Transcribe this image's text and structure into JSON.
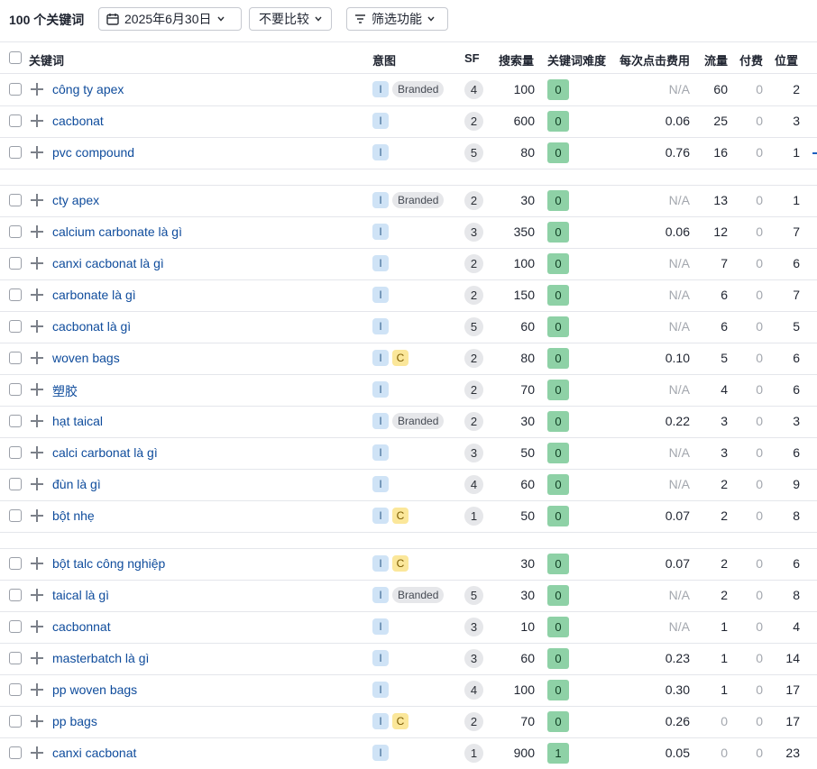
{
  "toolbar": {
    "title": "100 个关键词",
    "date_label": "2025年6月30日",
    "compare_label": "不要比较",
    "filter_label": "筛选功能"
  },
  "columns": {
    "keyword": "关键词",
    "intent": "意图",
    "sf": "SF",
    "volume": "搜索量",
    "kd": "关键词难度",
    "cpc": "每次点击费用",
    "traffic": "流量",
    "paid": "付费",
    "position": "位置"
  },
  "rows": [
    {
      "keyword": "công ty apex",
      "intent": [
        "I",
        "Branded"
      ],
      "sf": "4",
      "volume": "100",
      "kd": "0",
      "cpc": "N/A",
      "traffic": "60",
      "paid": "0",
      "position": "2"
    },
    {
      "keyword": "cacbonat",
      "intent": [
        "I"
      ],
      "sf": "2",
      "volume": "600",
      "kd": "0",
      "cpc": "0.06",
      "traffic": "25",
      "paid": "0",
      "position": "3"
    },
    {
      "keyword": "pvc compound",
      "intent": [
        "I"
      ],
      "sf": "5",
      "volume": "80",
      "kd": "0",
      "cpc": "0.76",
      "traffic": "16",
      "paid": "0",
      "position": "1"
    },
    {
      "keyword": "cty apex",
      "intent": [
        "I",
        "Branded"
      ],
      "sf": "2",
      "volume": "30",
      "kd": "0",
      "cpc": "N/A",
      "traffic": "13",
      "paid": "0",
      "position": "1"
    },
    {
      "keyword": "calcium carbonate là gì",
      "intent": [
        "I"
      ],
      "sf": "3",
      "volume": "350",
      "kd": "0",
      "cpc": "0.06",
      "traffic": "12",
      "paid": "0",
      "position": "7"
    },
    {
      "keyword": "canxi cacbonat là gì",
      "intent": [
        "I"
      ],
      "sf": "2",
      "volume": "100",
      "kd": "0",
      "cpc": "N/A",
      "traffic": "7",
      "paid": "0",
      "position": "6"
    },
    {
      "keyword": "carbonate là gì",
      "intent": [
        "I"
      ],
      "sf": "2",
      "volume": "150",
      "kd": "0",
      "cpc": "N/A",
      "traffic": "6",
      "paid": "0",
      "position": "7"
    },
    {
      "keyword": "cacbonat là gì",
      "intent": [
        "I"
      ],
      "sf": "5",
      "volume": "60",
      "kd": "0",
      "cpc": "N/A",
      "traffic": "6",
      "paid": "0",
      "position": "5"
    },
    {
      "keyword": "woven bags",
      "intent": [
        "I",
        "C"
      ],
      "sf": "2",
      "volume": "80",
      "kd": "0",
      "cpc": "0.10",
      "traffic": "5",
      "paid": "0",
      "position": "6"
    },
    {
      "keyword": "塑胶",
      "intent": [
        "I"
      ],
      "sf": "2",
      "volume": "70",
      "kd": "0",
      "cpc": "N/A",
      "traffic": "4",
      "paid": "0",
      "position": "6"
    },
    {
      "keyword": "hạt taical",
      "intent": [
        "I",
        "Branded"
      ],
      "sf": "2",
      "volume": "30",
      "kd": "0",
      "cpc": "0.22",
      "traffic": "3",
      "paid": "0",
      "position": "3"
    },
    {
      "keyword": "calci carbonat là gì",
      "intent": [
        "I"
      ],
      "sf": "3",
      "volume": "50",
      "kd": "0",
      "cpc": "N/A",
      "traffic": "3",
      "paid": "0",
      "position": "6"
    },
    {
      "keyword": "đùn là gì",
      "intent": [
        "I"
      ],
      "sf": "4",
      "volume": "60",
      "kd": "0",
      "cpc": "N/A",
      "traffic": "2",
      "paid": "0",
      "position": "9"
    },
    {
      "keyword": "bột nhẹ",
      "intent": [
        "I",
        "C"
      ],
      "sf": "1",
      "volume": "50",
      "kd": "0",
      "cpc": "0.07",
      "traffic": "2",
      "paid": "0",
      "position": "8"
    },
    {
      "keyword": "bột talc công nghiệp",
      "intent": [
        "I",
        "C"
      ],
      "sf": "",
      "volume": "30",
      "kd": "0",
      "cpc": "0.07",
      "traffic": "2",
      "paid": "0",
      "position": "6"
    },
    {
      "keyword": "taical là gì",
      "intent": [
        "I",
        "Branded"
      ],
      "sf": "5",
      "volume": "30",
      "kd": "0",
      "cpc": "N/A",
      "traffic": "2",
      "paid": "0",
      "position": "8"
    },
    {
      "keyword": "cacbonnat",
      "intent": [
        "I"
      ],
      "sf": "3",
      "volume": "10",
      "kd": "0",
      "cpc": "N/A",
      "traffic": "1",
      "paid": "0",
      "position": "4"
    },
    {
      "keyword": "masterbatch là gì",
      "intent": [
        "I"
      ],
      "sf": "3",
      "volume": "60",
      "kd": "0",
      "cpc": "0.23",
      "traffic": "1",
      "paid": "0",
      "position": "14"
    },
    {
      "keyword": "pp woven bags",
      "intent": [
        "I"
      ],
      "sf": "4",
      "volume": "100",
      "kd": "0",
      "cpc": "0.30",
      "traffic": "1",
      "paid": "0",
      "position": "17"
    },
    {
      "keyword": "pp bags",
      "intent": [
        "I",
        "C"
      ],
      "sf": "2",
      "volume": "70",
      "kd": "0",
      "cpc": "0.26",
      "traffic": "0",
      "paid": "0",
      "position": "17"
    },
    {
      "keyword": "canxi cacbonat",
      "intent": [
        "I"
      ],
      "sf": "1",
      "volume": "900",
      "kd": "1",
      "cpc": "0.05",
      "traffic": "0",
      "paid": "0",
      "position": "23"
    }
  ],
  "colors": {
    "link": "#0f4c9c",
    "kd_easy": "#8ed1a6",
    "intent_informational": "#cfe3f6",
    "intent_commercial": "#fbe79a",
    "badge_gray": "#e6e7ea",
    "muted_text": "#a3a7ae"
  },
  "icons": {
    "date": "calendar-icon",
    "filter": "filter-icon",
    "dropdown": "chevron-down-icon",
    "expand": "plus-icon"
  }
}
